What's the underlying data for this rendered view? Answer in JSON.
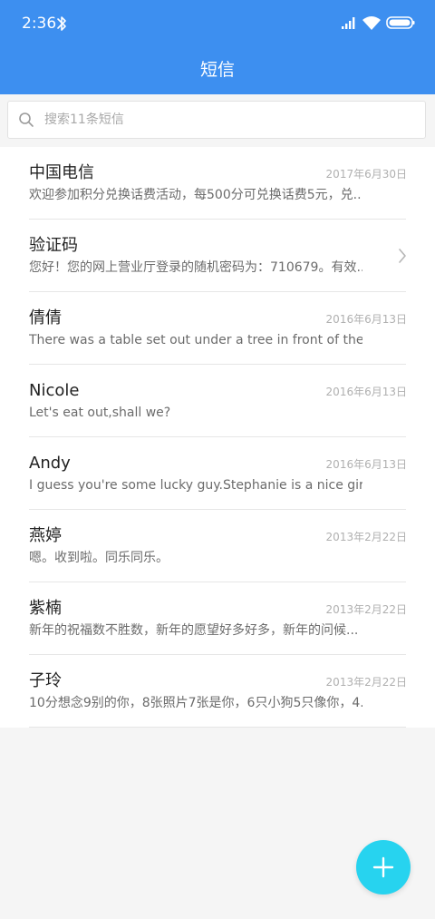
{
  "status_bar": {
    "time": "2:36"
  },
  "header": {
    "title": "短信"
  },
  "search": {
    "placeholder": "搜索11条短信"
  },
  "conversations": [
    {
      "name": "中国电信",
      "date": "2017年6月30日",
      "preview": "欢迎参加积分兑换话费活动，每500分可兑换话费5元，兑..."
    },
    {
      "name": "验证码",
      "date": "",
      "preview": "您好！您的网上营业厅登录的随机密码为：710679。有效..."
    },
    {
      "name": "倩倩",
      "date": "2016年6月13日",
      "preview": "There was a table set out under a tree in front of the h..."
    },
    {
      "name": "Nicole",
      "date": "2016年6月13日",
      "preview": "Let's eat out,shall we?"
    },
    {
      "name": "Andy",
      "date": "2016年6月13日",
      "preview": "I guess you're some lucky guy.Stephanie is a nice girl."
    },
    {
      "name": "燕婷",
      "date": "2013年2月22日",
      "preview": "嗯。收到啦。同乐同乐。"
    },
    {
      "name": "紫楠",
      "date": "2013年2月22日",
      "preview": "新年的祝福数不胜数，新年的愿望好多好多，新年的问候..."
    },
    {
      "name": "子玲",
      "date": "2013年2月22日",
      "preview": "10分想念9别的你，8张照片7张是你，6只小狗5只像你，4..."
    }
  ],
  "icons": {
    "status": [
      "bluetooth-icon",
      "signal-icon",
      "wifi-icon",
      "battery-icon"
    ],
    "search": "search-icon",
    "row_action": "chevron-right-icon",
    "fab": "plus-icon"
  },
  "colors": {
    "header": "#3d8ff0",
    "fab": "#27d3ef",
    "background": "#f5f5f5"
  }
}
